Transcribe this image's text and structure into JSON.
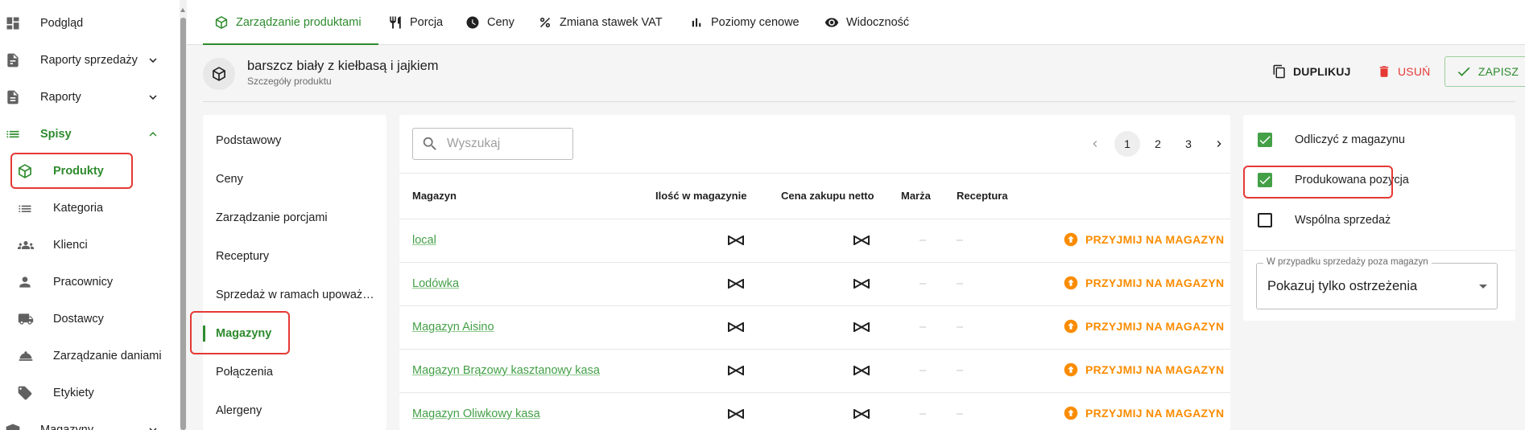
{
  "sidebar": {
    "items": [
      {
        "label": "Podgląd",
        "icon": "dashboard-icon"
      },
      {
        "label": "Raporty sprzedaży",
        "icon": "sales-report-icon",
        "expand": "chevron-down"
      },
      {
        "label": "Raporty",
        "icon": "report-icon",
        "expand": "chevron-down"
      },
      {
        "label": "Spisy",
        "icon": "list-icon",
        "expand": "chevron-up"
      },
      {
        "label": "Produkty",
        "icon": "cube-icon"
      },
      {
        "label": "Kategoria",
        "icon": "category-list-icon"
      },
      {
        "label": "Klienci",
        "icon": "clients-icon"
      },
      {
        "label": "Pracownicy",
        "icon": "person-icon"
      },
      {
        "label": "Dostawcy",
        "icon": "truck-icon"
      },
      {
        "label": "Zarządzanie daniami",
        "icon": "cloche-icon"
      },
      {
        "label": "Etykiety",
        "icon": "tags-icon"
      },
      {
        "label": "Magazyny",
        "icon": "warehouse-icon",
        "expand": "chevron-down"
      }
    ],
    "active": "Produkty"
  },
  "tabs": [
    {
      "label": "Zarządzanie produktami",
      "icon": "cube-icon",
      "active": true
    },
    {
      "label": "Porcja",
      "icon": "cutlery-icon"
    },
    {
      "label": "Ceny",
      "icon": "clock-icon"
    },
    {
      "label": "Zmiana stawek VAT",
      "icon": "percent-icon"
    },
    {
      "label": "Poziomy cenowe",
      "icon": "bar-chart-icon"
    },
    {
      "label": "Widoczność",
      "icon": "eye-icon"
    }
  ],
  "product": {
    "title": "barszcz biały z kiełbasą i jajkiem",
    "subtitle": "Szczegóły produktu"
  },
  "actions": {
    "duplicate": "DUPLIKUJ",
    "delete": "USUŃ",
    "save": "ZAPISZ"
  },
  "sections": {
    "items": [
      "Podstawowy",
      "Ceny",
      "Zarządzanie porcjami",
      "Receptury",
      "Sprzedaż w ramach upoważ…",
      "Magazyny",
      "Połączenia",
      "Alergeny"
    ],
    "active": "Magazyny"
  },
  "warehouse_table": {
    "search_placeholder": "Wyszukaj",
    "pages": [
      "1",
      "2",
      "3"
    ],
    "current_page": "1",
    "columns": [
      "Magazyn",
      "Ilość w magazynie",
      "Cena zakupu netto",
      "Marża",
      "Receptura"
    ],
    "rows": [
      {
        "name": "local",
        "stock": "infinity",
        "price": "infinity",
        "margin": "–",
        "recipe": "–",
        "action": "PRZYJMIJ NA MAGAZYN"
      },
      {
        "name": "Lodówka",
        "stock": "infinity",
        "price": "infinity",
        "margin": "–",
        "recipe": "–",
        "action": "PRZYJMIJ NA MAGAZYN"
      },
      {
        "name": "Magazyn Aisino",
        "stock": "infinity",
        "price": "infinity",
        "margin": "–",
        "recipe": "–",
        "action": "PRZYJMIJ NA MAGAZYN"
      },
      {
        "name": "Magazyn Brązowy kasztanowy kasa",
        "stock": "infinity",
        "price": "infinity",
        "margin": "–",
        "recipe": "–",
        "action": "PRZYJMIJ NA MAGAZYN"
      },
      {
        "name": "Magazyn Oliwkowy kasa",
        "stock": "infinity",
        "price": "infinity",
        "margin": "–",
        "recipe": "–",
        "action": "PRZYJMIJ NA MAGAZYN"
      }
    ]
  },
  "options": {
    "items": [
      {
        "label": "Odliczyć z magazynu",
        "checked": true
      },
      {
        "label": "Produkowana pozycja",
        "checked": true
      },
      {
        "label": "Wspólna sprzedaż",
        "checked": false
      }
    ],
    "select_label": "W przypadku sprzedaży poza magazyn",
    "select_value": "Pokazuj tylko ostrzeżenia"
  },
  "colors": {
    "accent_green": "#2e8b2e",
    "link_green": "#43a047",
    "warning_orange": "#fb8c00",
    "danger_red": "#e53935",
    "highlight_red": "#e53935"
  }
}
